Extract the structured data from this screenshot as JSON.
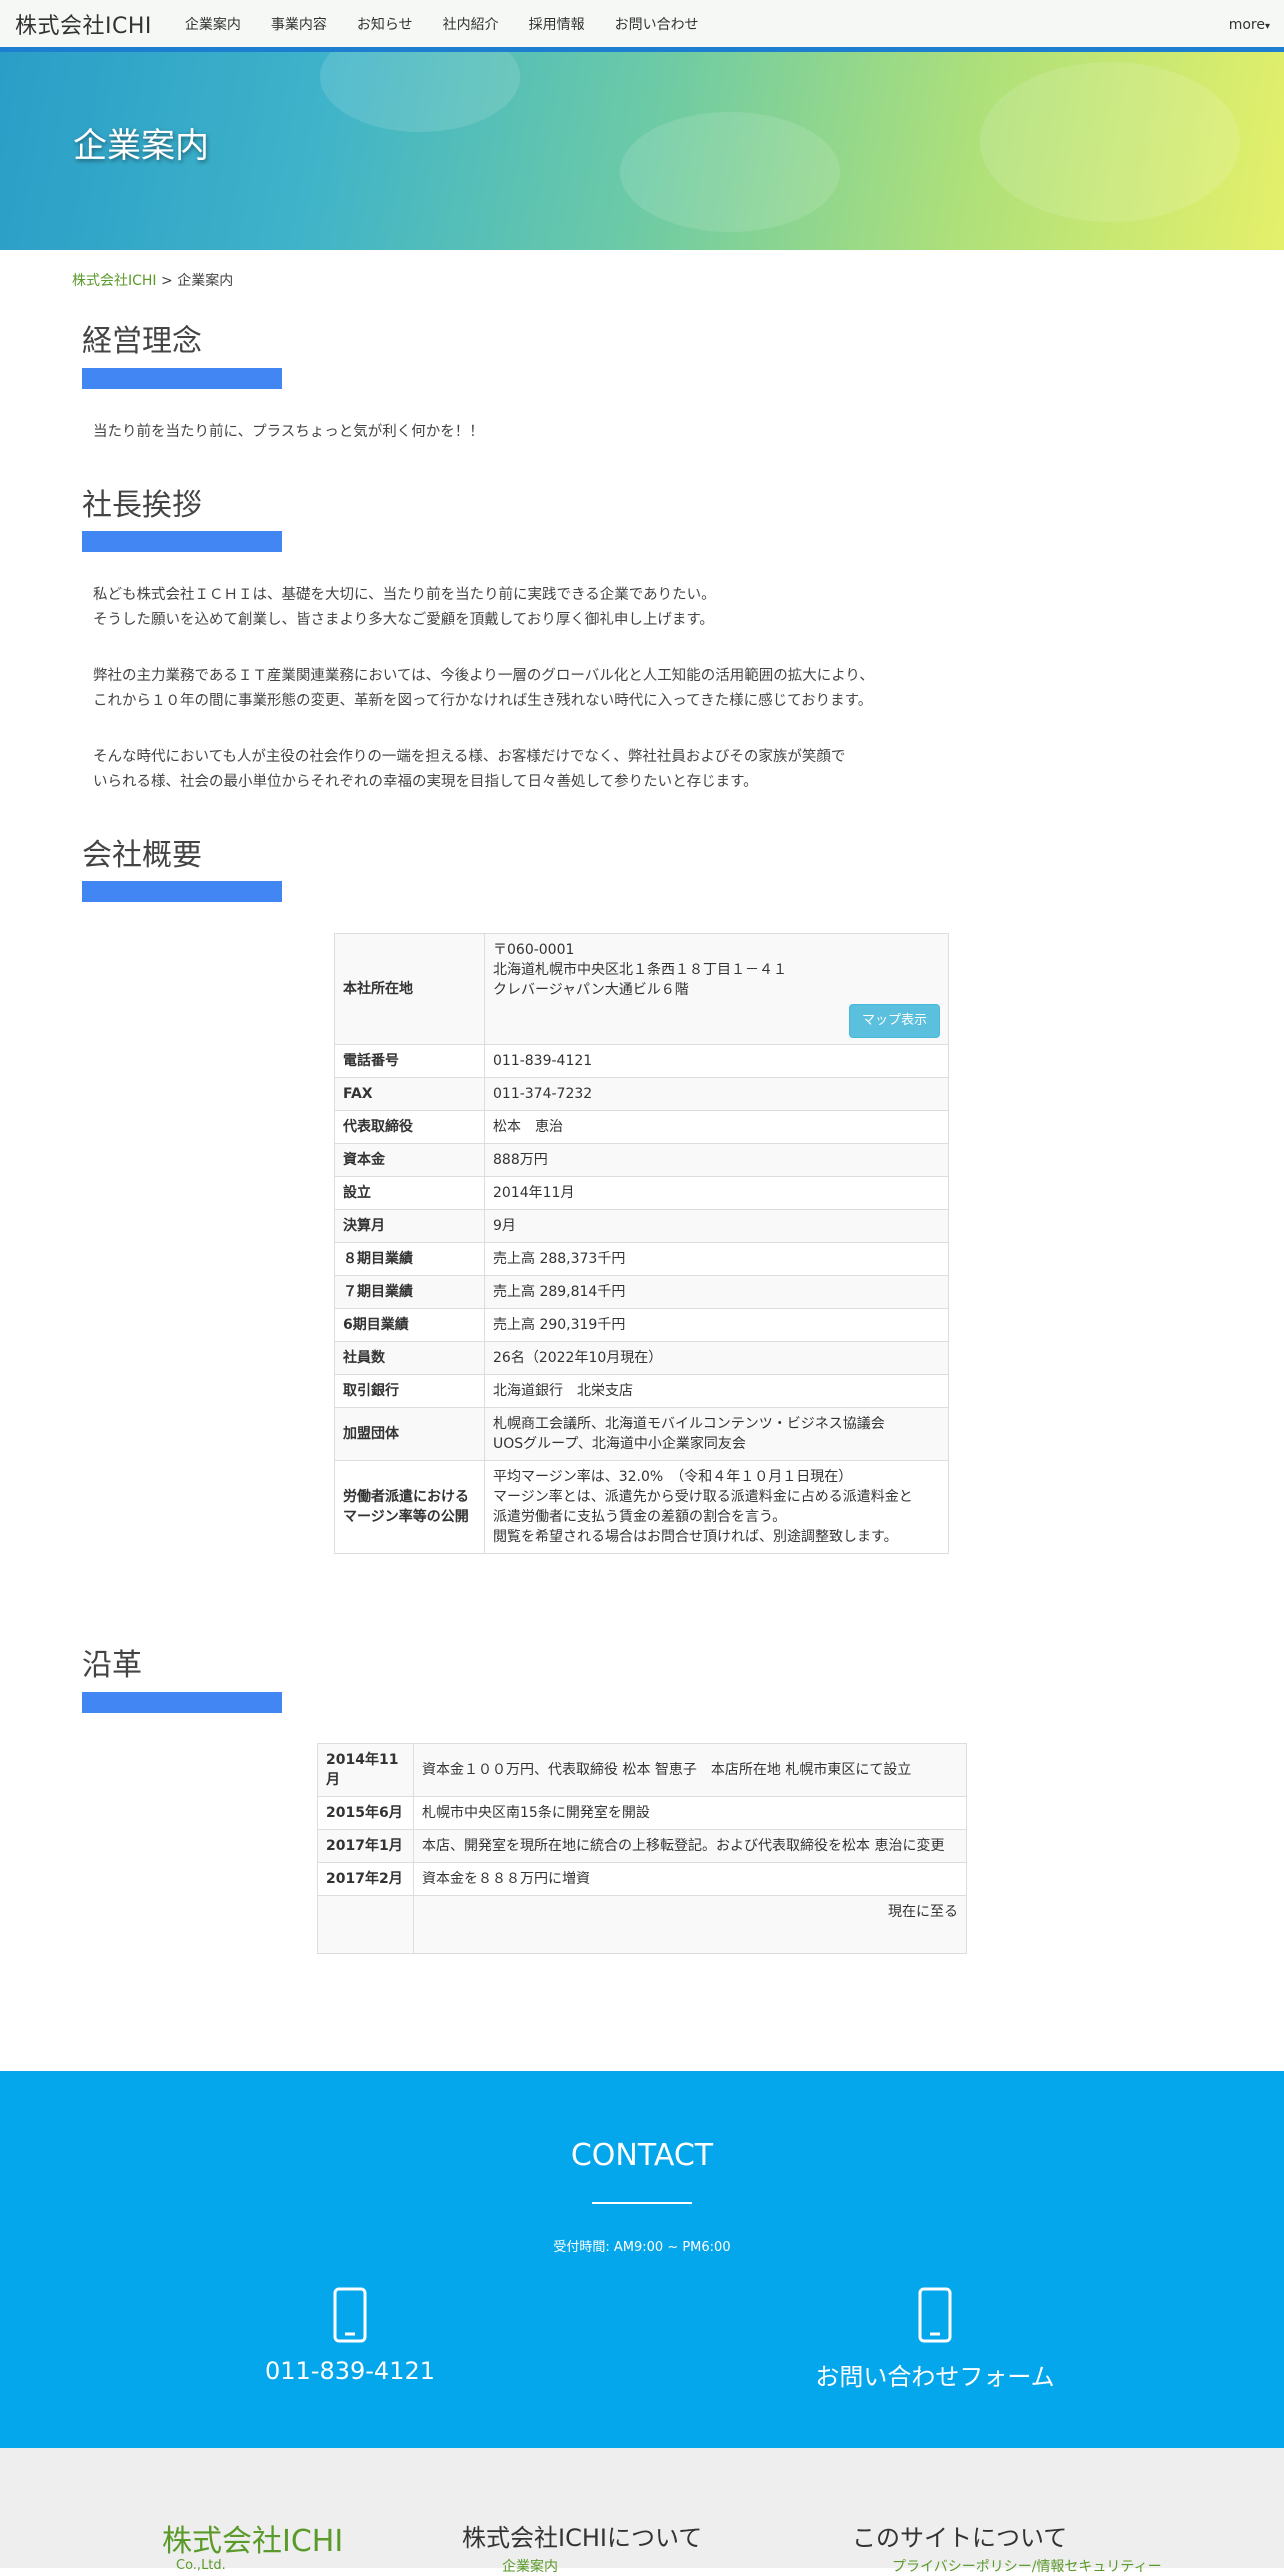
{
  "nav": {
    "brand": "株式会社ICHI",
    "items": [
      "企業案内",
      "事業内容",
      "お知らせ",
      "社内紹介",
      "採用情報",
      "お問い合わせ"
    ],
    "more": "more",
    "accent": "#1e7fd0"
  },
  "hero": {
    "title": "企業案内"
  },
  "breadcrumb": {
    "home": "株式会社ICHI",
    "separator": ">",
    "current": "企業案内"
  },
  "philosophy": {
    "title": "経営理念",
    "text": "当たり前を当たり前に、プラスちょっと気が利く何かを！！"
  },
  "greeting": {
    "title": "社長挨拶",
    "lines": [
      "私ども株式会社ＩＣＨＩは、基礎を大切に、当たり前を当たり前に実践できる企業でありたい。",
      "そうした願いを込めて創業し、皆さまより多大なご愛顧を頂戴しており厚く御礼申し上げます。",
      "",
      "弊社の主力業務であるＩＴ産業関連業務においては、今後より一層のグローバル化と人工知能の活用範囲の拡大により、",
      "これから１０年の間に事業形態の変更、革新を図って行かなければ生き残れない時代に入ってきた様に感じております。",
      "",
      "そんな時代においても人が主役の社会作りの一端を担える様、お客様だけでなく、弊社社員およびその家族が笑顔で",
      "いられる様、社会の最小単位からそれぞれの幸福の実現を目指して日々善処して参りたいと存じます。"
    ]
  },
  "overview": {
    "title": "会社概要",
    "address_label": "本社所在地",
    "address_lines": [
      "〒060-0001",
      "北海道札幌市中央区北１条西１８丁目１－４１",
      "クレバージャパン大通ビル６階"
    ],
    "map_button": "マップ表示",
    "rows": [
      {
        "k": "電話番号",
        "v": "011-839-4121"
      },
      {
        "k": "FAX",
        "v": "011-374-7232"
      },
      {
        "k": "代表取締役",
        "v": "松本　恵治"
      },
      {
        "k": "資本金",
        "v": "888万円"
      },
      {
        "k": "設立",
        "v": "2014年11月"
      },
      {
        "k": "決算月",
        "v": "9月"
      },
      {
        "k": "８期目業績",
        "v": "売上高 288,373千円"
      },
      {
        "k": "７期目業績",
        "v": "売上高 289,814千円"
      },
      {
        "k": "6期目業績",
        "v": "売上高 290,319千円"
      },
      {
        "k": "社員数",
        "v": "26名（2022年10月現在）"
      },
      {
        "k": "取引銀行",
        "v": "北海道銀行　北栄支店"
      }
    ],
    "groups_label": "加盟団体",
    "groups_lines": [
      "札幌商工会議所、北海道モバイルコンテンツ・ビジネス協議会",
      "UOSグループ、北海道中小企業家同友会"
    ],
    "margin_label": "労働者派遣における マージン率等の公開",
    "margin_lines": [
      "平均マージン率は、32.0%　（令和４年１０月１日現在）",
      "マージン率とは、派遣先から受け取る派遣料金に占める派遣料金と",
      "派遣労働者に支払う賃金の差額の割合を言う。",
      "閲覧を希望される場合はお問合せ頂ければ、別途調整致します。"
    ]
  },
  "history": {
    "title": "沿革",
    "rows": [
      {
        "k": "2014年11月",
        "v": "資本金１００万円、代表取締役 松本 智恵子　本店所在地 札幌市東区にて設立"
      },
      {
        "k": "2015年6月",
        "v": "札幌市中央区南15条に開発室を開設"
      },
      {
        "k": "2017年1月",
        "v": "本店、開発室を現所在地に統合の上移転登記。および代表取締役を松本 恵治に変更"
      },
      {
        "k": "2017年2月",
        "v": "資本金を８８８万円に増資"
      }
    ],
    "final": "現在に至る"
  },
  "contact": {
    "title": "CONTACT",
    "hours": "受付時間: AM9:00 ~ PM6:00",
    "phone": "011-839-4121",
    "form": "お問い合わせフォーム",
    "background": "#04a7ec"
  },
  "footer": {
    "brand": "株式会社ICHI",
    "brand_sub": "Co.,Ltd.",
    "about_title": "株式会社ICHIについて",
    "about_link": "企業案内",
    "site_title": "このサイトについて",
    "site_link": "プライバシーポリシー/情報セキュリティー"
  }
}
